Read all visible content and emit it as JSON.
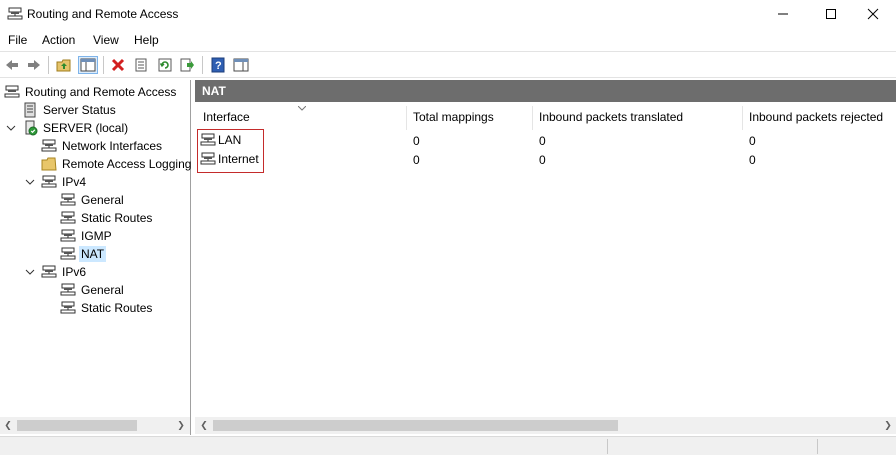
{
  "window": {
    "title": "Routing and Remote Access"
  },
  "menu": [
    "File",
    "Action",
    "View",
    "Help"
  ],
  "toolbar": {
    "buttons": [
      "back-icon",
      "forward-icon",
      "up-folder-icon",
      "show-hide-tree-icon",
      "delete-icon",
      "properties-icon",
      "refresh-icon",
      "export-list-icon",
      "help-icon",
      "show-hide-action-pane-icon"
    ]
  },
  "tree": {
    "root": "Routing and Remote Access",
    "server_status": "Server Status",
    "server": "SERVER (local)",
    "network_interfaces": "Network Interfaces",
    "remote_access_logging": "Remote Access Logging",
    "ipv4": "IPv4",
    "ipv4_general": "General",
    "ipv4_static_routes": "Static Routes",
    "ipv4_igmp": "IGMP",
    "ipv4_nat": "NAT",
    "ipv6": "IPv6",
    "ipv6_general": "General",
    "ipv6_static_routes": "Static Routes"
  },
  "panel": {
    "title": "NAT",
    "columns": [
      "Interface",
      "Total mappings",
      "Inbound packets translated",
      "Inbound packets rejected"
    ],
    "rows": [
      {
        "interface": "LAN",
        "total_mappings": "0",
        "inbound_translated": "0",
        "inbound_rejected": "0"
      },
      {
        "interface": "Internet",
        "total_mappings": "0",
        "inbound_translated": "0",
        "inbound_rejected": "0"
      }
    ]
  },
  "colors": {
    "selection": "#cce8ff",
    "panel_header": "#6d6d6d",
    "highlight_box": "#c42b2b"
  }
}
